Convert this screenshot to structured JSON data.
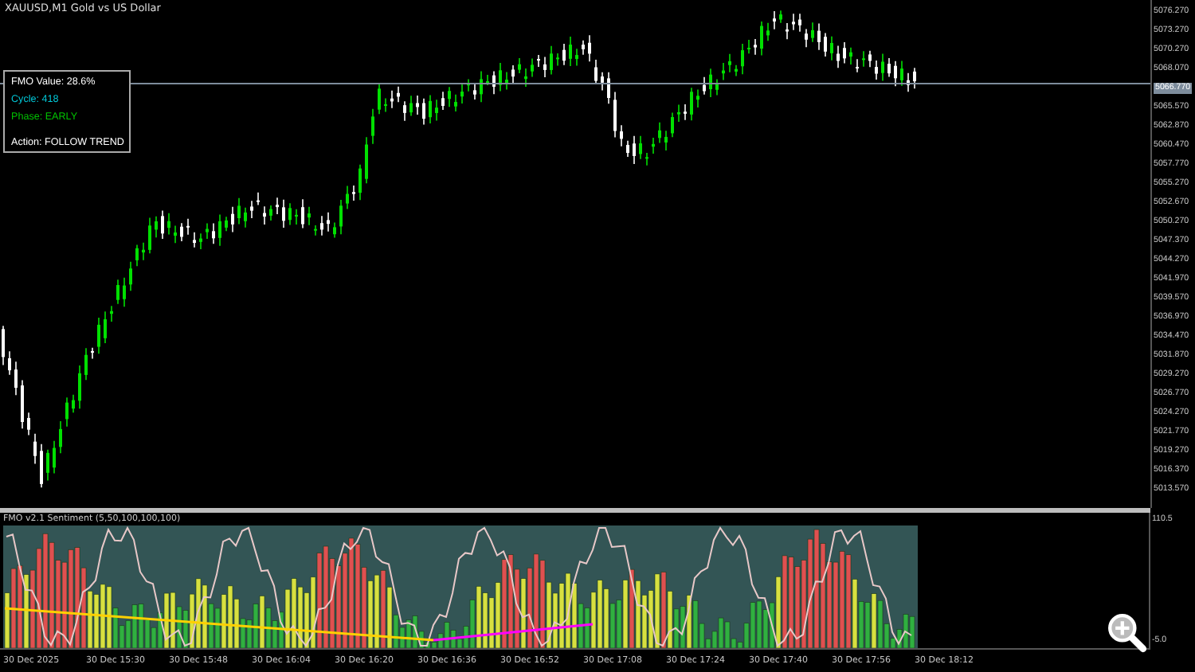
{
  "chart": {
    "title": "XAUUSD,M1  Gold vs US Dollar",
    "current_price": "5066.770",
    "price_labels": [
      "5076.270",
      "5073.270",
      "5070.270",
      "5068.070",
      "5065.570",
      "5062.870",
      "5060.470",
      "5057.770",
      "5055.270",
      "5052.670",
      "5050.270",
      "5047.370",
      "5044.270",
      "5041.970",
      "5039.570",
      "5036.970",
      "5034.470",
      "5031.870",
      "5029.270",
      "5026.770",
      "5024.270",
      "5021.770",
      "5019.270",
      "5016.370",
      "5013.570"
    ]
  },
  "info_panel": {
    "lines": [
      {
        "text": "FMO Value: 28.6%",
        "color": "#ffffff"
      },
      {
        "text": "Cycle: 418",
        "color": "#00c8d8"
      },
      {
        "text": "Phase: EARLY",
        "color": "#00c000"
      },
      {
        "text": "Action: FOLLOW TREND",
        "color": "#ffffff"
      }
    ]
  },
  "indicator": {
    "title": "FMO v2.1 Sentiment (5,50,100,100,100)",
    "scale_max": "110.5",
    "scale_min": "-5.0"
  },
  "time_labels": [
    "30 Dec 2025",
    "30 Dec 15:30",
    "30 Dec 15:48",
    "30 Dec 16:04",
    "30 Dec 16:20",
    "30 Dec 16:36",
    "30 Dec 16:52",
    "30 Dec 17:08",
    "30 Dec 17:24",
    "30 Dec 17:40",
    "30 Dec 17:56",
    "30 Dec 18:12"
  ]
}
